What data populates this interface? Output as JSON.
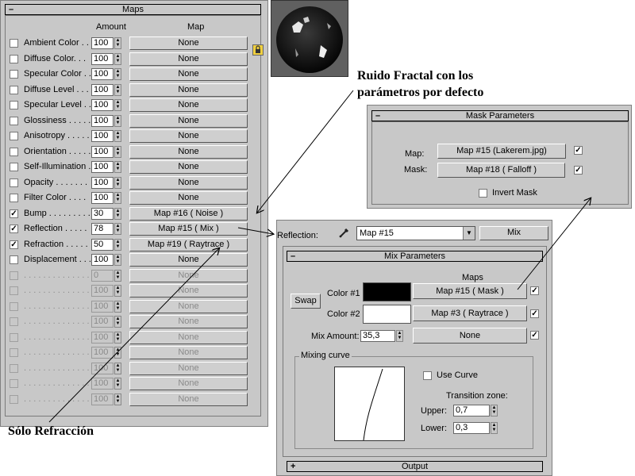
{
  "maps": {
    "title": "Maps",
    "col_amount": "Amount",
    "col_map": "Map",
    "rows": [
      {
        "label": "Ambient Color . .",
        "amount": "100",
        "map": "None",
        "checked": false,
        "enabled": true
      },
      {
        "label": "Diffuse Color. . .",
        "amount": "100",
        "map": "None",
        "checked": false,
        "enabled": true
      },
      {
        "label": "Specular Color . .",
        "amount": "100",
        "map": "None",
        "checked": false,
        "enabled": true
      },
      {
        "label": "Diffuse Level . . .",
        "amount": "100",
        "map": "None",
        "checked": false,
        "enabled": true
      },
      {
        "label": "Specular Level . .",
        "amount": "100",
        "map": "None",
        "checked": false,
        "enabled": true
      },
      {
        "label": "Glossiness . . . . .",
        "amount": "100",
        "map": "None",
        "checked": false,
        "enabled": true
      },
      {
        "label": "Anisotropy . . . . .",
        "amount": "100",
        "map": "None",
        "checked": false,
        "enabled": true
      },
      {
        "label": "Orientation . . . . .",
        "amount": "100",
        "map": "None",
        "checked": false,
        "enabled": true
      },
      {
        "label": "Self-Illumination .",
        "amount": "100",
        "map": "None",
        "checked": false,
        "enabled": true
      },
      {
        "label": "Opacity . . . . . . .",
        "amount": "100",
        "map": "None",
        "checked": false,
        "enabled": true
      },
      {
        "label": "Filter Color . . . .",
        "amount": "100",
        "map": "None",
        "checked": false,
        "enabled": true
      },
      {
        "label": "Bump . . . . . . . . .",
        "amount": "30",
        "map": "Map #16  ( Noise )",
        "checked": true,
        "enabled": true
      },
      {
        "label": "Reflection  . . . . .",
        "amount": "78",
        "map": "Map #15  ( Mix )",
        "checked": true,
        "enabled": true
      },
      {
        "label": "Refraction  . . . . .",
        "amount": "50",
        "map": "Map #19  ( Raytrace )",
        "checked": true,
        "enabled": true
      },
      {
        "label": "Displacement  . . .",
        "amount": "100",
        "map": "None",
        "checked": false,
        "enabled": true
      },
      {
        "label": ". . . . . . . . . . . . . .",
        "amount": "0",
        "map": "None",
        "checked": false,
        "enabled": false
      },
      {
        "label": ". . . . . . . . . . . . . .",
        "amount": "100",
        "map": "None",
        "checked": false,
        "enabled": false
      },
      {
        "label": ". . . . . . . . . . . . . .",
        "amount": "100",
        "map": "None",
        "checked": false,
        "enabled": false
      },
      {
        "label": ". . . . . . . . . . . . . .",
        "amount": "100",
        "map": "None",
        "checked": false,
        "enabled": false
      },
      {
        "label": ". . . . . . . . . . . . . .",
        "amount": "100",
        "map": "None",
        "checked": false,
        "enabled": false
      },
      {
        "label": ". . . . . . . . . . . . . .",
        "amount": "100",
        "map": "None",
        "checked": false,
        "enabled": false
      },
      {
        "label": ". . . . . . . . . . . . . .",
        "amount": "100",
        "map": "None",
        "checked": false,
        "enabled": false
      },
      {
        "label": ". . . . . . . . . . . . . .",
        "amount": "100",
        "map": "None",
        "checked": false,
        "enabled": false
      },
      {
        "label": ". . . . . . . . . . . . . .",
        "amount": "100",
        "map": "None",
        "checked": false,
        "enabled": false
      }
    ]
  },
  "captions": {
    "noise_1": "Ruido Fractal con los",
    "noise_2": "parámetros por defecto",
    "refraction": "Sólo Refracción"
  },
  "mask": {
    "title": "Mask Parameters",
    "map_label": "Map:",
    "map_value": "Map #15 (Lakerem.jpg)",
    "mask_label": "Mask:",
    "mask_value": "Map #18  ( Falloff )",
    "invert_label": "Invert Mask"
  },
  "reflection_bar": {
    "label": "Reflection:",
    "dropdown": "Map #15",
    "type_button": "Mix"
  },
  "mix": {
    "title": "Mix Parameters",
    "maps_header": "Maps",
    "swap": "Swap",
    "color1_label": "Color #1",
    "color1_map": "Map #15  ( Mask )",
    "color2_label": "Color #2",
    "color2_map": "Map #3  ( Raytrace )",
    "mix_amount_label": "Mix Amount:",
    "mix_amount_value": "35,3",
    "mix_map": "None",
    "curve_group": "Mixing curve",
    "use_curve": "Use Curve",
    "transition": "Transition zone:",
    "upper_label": "Upper:",
    "upper_value": "0,7",
    "lower_label": "Lower:",
    "lower_value": "0,3"
  },
  "output": {
    "title": "Output"
  },
  "colors": {
    "panel": "#c8c8c8",
    "color1": "#000000",
    "color2": "#ffffff"
  }
}
